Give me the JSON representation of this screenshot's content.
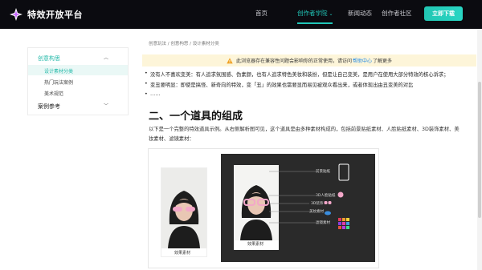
{
  "nav": {
    "logo_text": "特效开放平台",
    "items": [
      "首页",
      "创作者学院",
      "新闻动态",
      "创作者社区"
    ],
    "download_label": "立即下载"
  },
  "breadcrumb": "创意玩法 / 创意构思 / 设计素材分类",
  "sidebar": {
    "group1": "创意构思",
    "items": [
      "设计素材分类",
      "热门玩法案例",
      "美术规范"
    ],
    "group2": "案例参考"
  },
  "notice": {
    "before": "此浏览器存在兼容性问题会影响你的正常使用，请访问",
    "link": "帮助中心",
    "after": "了解更多"
  },
  "bullets": [
    "没有人不喜欢变美：有人追求氛围感、伪素颜，也有人追求特色美妆和装扮，但是让自己变美，是用户在使用大部分特效的核心诉求；",
    "变丑要明显：即使是搞怪、新奇向的特效，变「丑」的效果也需要显而易见被观众看出来，或者体现出由丑变美的对比",
    "……"
  ],
  "section_title": "二、一个道具的组成",
  "paragraph": [
    "以下是一个完整的特效道具示例。从右侧解析图可见，这个道具是由多种素材构成的，包括前景贴纸素材、人脸贴纸素材、3D装饰素材、美",
    "妆素材、滤镜素材："
  ],
  "demo": {
    "caption": "效果素材",
    "labels": [
      "前景贴纸",
      "3D人脸贴纸",
      "3D装饰",
      "美妆素材",
      "滤镜素材"
    ]
  },
  "colors": {
    "accent": "#21c7b9",
    "topbar": "#0b0b10",
    "notice_bg": "#fdf5d9",
    "link": "#1e88e5"
  }
}
